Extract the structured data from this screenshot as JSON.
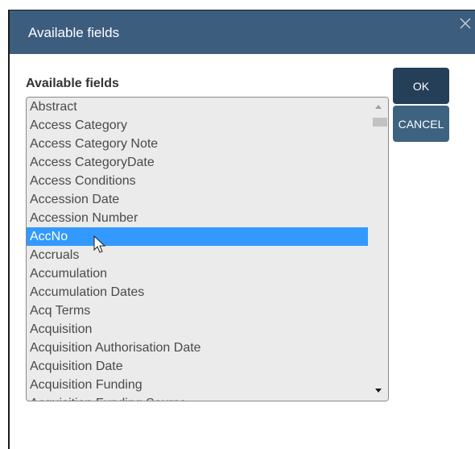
{
  "dialog": {
    "title": "Available fields",
    "close_icon": "close-icon"
  },
  "field_label": "Available fields",
  "buttons": {
    "ok": "OK",
    "cancel": "CANCEL"
  },
  "listbox": {
    "selected_value": "AccNo",
    "items": [
      {
        "label": "Abstract"
      },
      {
        "label": "Access Category"
      },
      {
        "label": "Access Category Note"
      },
      {
        "label": "Access CategoryDate"
      },
      {
        "label": "Access Conditions"
      },
      {
        "label": "Accession Date"
      },
      {
        "label": "Accession Number"
      },
      {
        "label": "AccNo",
        "selected": true
      },
      {
        "label": "Accruals"
      },
      {
        "label": "Accumulation"
      },
      {
        "label": "Accumulation Dates"
      },
      {
        "label": "Acq Terms"
      },
      {
        "label": "Acquisition"
      },
      {
        "label": "Acquisition Authorisation Date"
      },
      {
        "label": "Acquisition Date"
      },
      {
        "label": "Acquisition Funding"
      },
      {
        "label": "Acquisition Funding Source"
      }
    ]
  },
  "colors": {
    "titlebar": "#3d5d7f",
    "selection": "#3399ff",
    "ok_button": "#253f58",
    "cancel_button": "#3d6380"
  },
  "cursor_icon": "mouse-pointer-icon"
}
